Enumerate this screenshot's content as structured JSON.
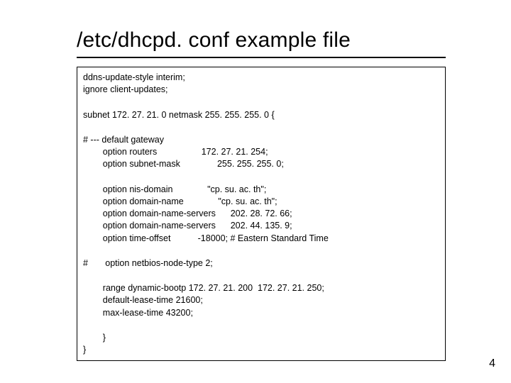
{
  "title": "/etc/dhcpd. conf example file",
  "code": {
    "l1": "ddns-update-style interim;",
    "l2": "ignore client-updates;",
    "l3": "subnet 172. 27. 21. 0 netmask 255. 255. 255. 0 {",
    "l4": "# --- default gateway",
    "l5": "        option routers                  172. 27. 21. 254;",
    "l6": "        option subnet-mask               255. 255. 255. 0;",
    "l7": "        option nis-domain              \"cp. su. ac. th\";",
    "l8": "        option domain-name              \"cp. su. ac. th\";",
    "l9": "        option domain-name-servers      202. 28. 72. 66;",
    "l10": "        option domain-name-servers      202. 44. 135. 9;",
    "l11": "        option time-offset           -18000; # Eastern Standard Time",
    "l12": "#       option netbios-node-type 2;",
    "l13": "        range dynamic-bootp 172. 27. 21. 200  172. 27. 21. 250;",
    "l14": "        default-lease-time 21600;",
    "l15": "        max-lease-time 43200;",
    "l16": "        }",
    "l17": "}"
  },
  "page_number": "4"
}
